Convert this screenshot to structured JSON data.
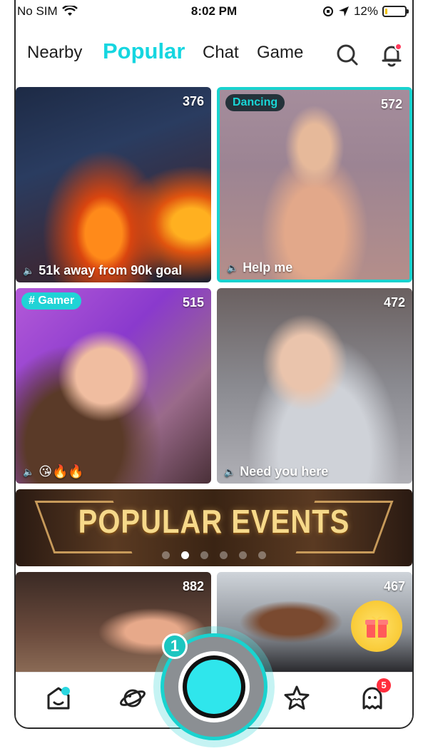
{
  "status_bar": {
    "carrier": "No SIM",
    "time": "8:02 PM",
    "battery": "12%",
    "battery_level": 0.12
  },
  "nav": {
    "tabs": [
      {
        "label": "Nearby"
      },
      {
        "label": "Popular"
      },
      {
        "label": "Chat"
      },
      {
        "label": "Game"
      }
    ],
    "active_tab": "Popular",
    "accent_color": "#15d6e0"
  },
  "streams": [
    {
      "viewers": "376",
      "caption": "51k away from 90k goal",
      "tag": ""
    },
    {
      "viewers": "572",
      "caption": "Help me",
      "tag": "Dancing"
    },
    {
      "viewers": "515",
      "caption": "😘🔥🔥",
      "tag": "# Gamer"
    },
    {
      "viewers": "472",
      "caption": "Need you here",
      "tag": ""
    },
    {
      "viewers": "882",
      "caption": "",
      "tag": ""
    },
    {
      "viewers": "467",
      "caption": "",
      "tag": ""
    }
  ],
  "banner": {
    "title": "POPULAR EVENTS",
    "page_count": 6,
    "active_page": 2
  },
  "go_live": {
    "step": "1"
  },
  "bottom_tabs": {
    "items": [
      {
        "name": "home",
        "icon": "home-icon"
      },
      {
        "name": "explore",
        "icon": "planet-icon"
      },
      {
        "name": "go-live",
        "icon": "record-icon"
      },
      {
        "name": "favorites",
        "icon": "star-face-icon"
      },
      {
        "name": "messages",
        "icon": "ghost-icon",
        "badge": "5"
      }
    ]
  }
}
